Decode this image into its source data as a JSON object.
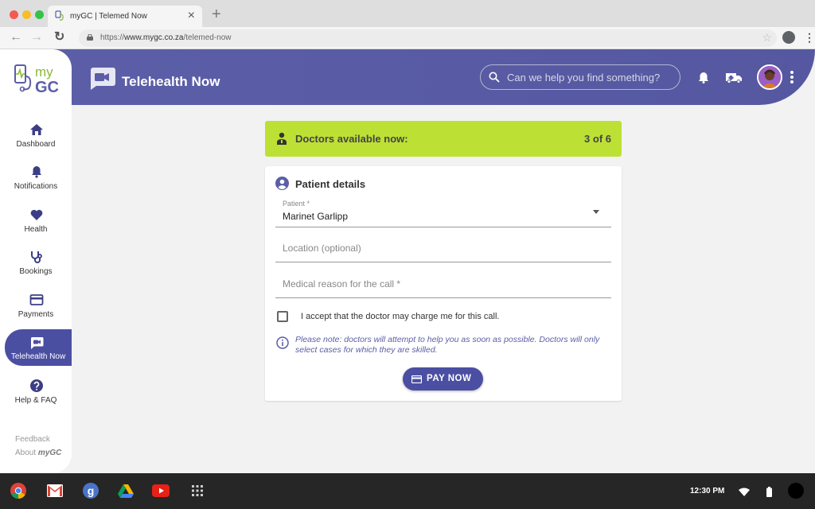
{
  "browser": {
    "tab_title": "myGC | Telemed Now",
    "url_prefix": "https://",
    "url_host": "www.mygc.co.za",
    "url_path": "/telemed-now"
  },
  "header": {
    "title": "Telehealth Now",
    "search_placeholder": "Can we help you find something?"
  },
  "logo": {
    "line1": "my",
    "line2": "GC"
  },
  "sidebar": {
    "items": [
      {
        "label": "Dashboard",
        "icon": "home-icon"
      },
      {
        "label": "Notifications",
        "icon": "bell-icon"
      },
      {
        "label": "Health",
        "icon": "heart-icon"
      },
      {
        "label": "Bookings",
        "icon": "stethoscope-icon"
      },
      {
        "label": "Payments",
        "icon": "credit-card-icon"
      },
      {
        "label": "Telehealth Now",
        "icon": "video-camera-icon",
        "active": true
      },
      {
        "label": "Help & FAQ",
        "icon": "help-icon"
      }
    ],
    "feedback": "Feedback",
    "about_prefix": "About ",
    "about_brand": "myGC"
  },
  "banner": {
    "label": "Doctors available now:",
    "count": "3 of 6"
  },
  "form": {
    "title": "Patient details",
    "patient_label": "Patient *",
    "patient_value": "Marinet Garlipp",
    "location_placeholder": "Location (optional)",
    "reason_placeholder": "Medical reason for the call *",
    "accept_label": "I accept that the doctor may charge me for this call.",
    "note": "Please note: doctors will attempt to help you as soon as possible. Doctors will only select cases for which they are skilled.",
    "pay_label": "PAY NOW"
  },
  "taskbar": {
    "time": "12:30 PM",
    "apps": [
      "chrome-icon",
      "gmail-icon",
      "google-icon",
      "drive-icon",
      "youtube-icon",
      "app-launcher-icon"
    ]
  },
  "colors": {
    "primary": "#5b5ea6",
    "accent": "#bde034",
    "active_nav": "#4b4fa2"
  }
}
